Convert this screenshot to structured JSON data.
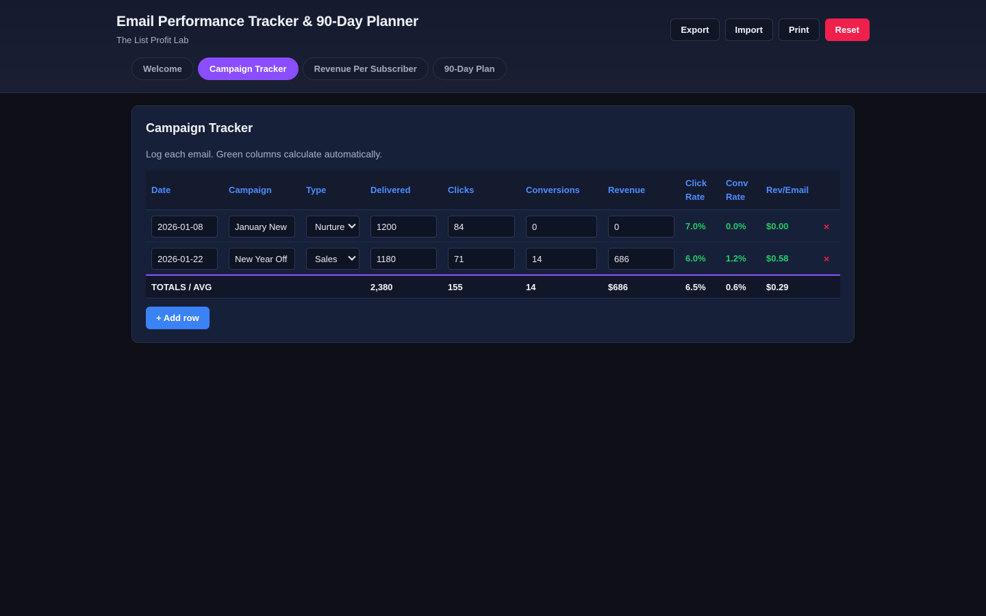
{
  "header": {
    "title": "Email Performance Tracker & 90-Day Planner",
    "subtitle": "The List Profit Lab",
    "actions": {
      "export": "Export",
      "import": "Import",
      "print": "Print",
      "reset": "Reset"
    }
  },
  "tabs": [
    {
      "label": "Welcome"
    },
    {
      "label": "Campaign Tracker"
    },
    {
      "label": "Revenue Per Subscriber"
    },
    {
      "label": "90-Day Plan"
    }
  ],
  "tracker": {
    "title": "Campaign Tracker",
    "description": "Log each email. Green columns calculate automatically.",
    "columns": {
      "date": "Date",
      "campaign": "Campaign",
      "type": "Type",
      "delivered": "Delivered",
      "clicks": "Clicks",
      "conversions": "Conversions",
      "revenue": "Revenue",
      "click_rate_1": "Click",
      "click_rate_2": "Rate",
      "conv_rate_1": "Conv",
      "conv_rate_2": "Rate",
      "rev_email": "Rev/Email"
    },
    "rows": [
      {
        "date": "2026-01-08",
        "campaign": "January New",
        "type": "Nurture",
        "delivered": "1200",
        "clicks": "84",
        "conversions": "0",
        "revenue": "0",
        "click_rate": "7.0%",
        "conv_rate": "0.0%",
        "rev_email": "$0.00",
        "delete": "×"
      },
      {
        "date": "2026-01-22",
        "campaign": "New Year Off",
        "type": "Sales",
        "delivered": "1180",
        "clicks": "71",
        "conversions": "14",
        "revenue": "686",
        "click_rate": "6.0%",
        "conv_rate": "1.2%",
        "rev_email": "$0.58",
        "delete": "×"
      }
    ],
    "totals": {
      "label": "TOTALS / AVG",
      "delivered": "2,380",
      "clicks": "155",
      "conversions": "14",
      "revenue": "$686",
      "click_rate": "6.5%",
      "conv_rate": "0.6%",
      "rev_email": "$0.29"
    },
    "add_row": "+ Add row"
  },
  "colors": {
    "accent_purple": "#8a4dff",
    "header_blue": "#4d8dff",
    "calc_green": "#22cc66",
    "danger_red": "#f0204d",
    "button_blue": "#3b82f6"
  }
}
